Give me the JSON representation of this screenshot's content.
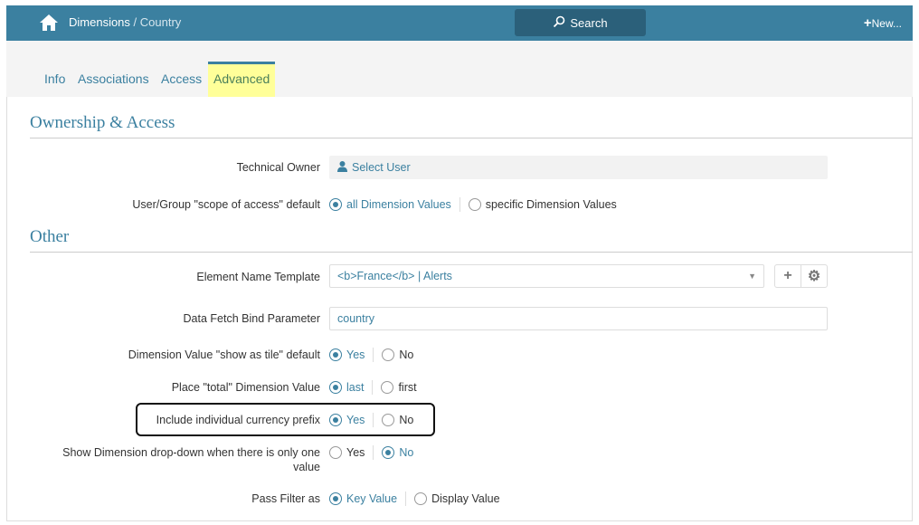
{
  "header": {
    "breadcrumb_main": "Dimensions",
    "breadcrumb_sub": "Country",
    "search_label": "Search",
    "new_label": "New..."
  },
  "tabs": [
    "Info",
    "Associations",
    "Access",
    "Advanced"
  ],
  "sections": {
    "ownership": "Ownership & Access",
    "other": "Other"
  },
  "fields": {
    "technical_owner": {
      "label": "Technical Owner",
      "value": "Select User"
    },
    "scope": {
      "label": "User/Group \"scope of access\" default",
      "options": [
        "all Dimension Values",
        "specific Dimension Values"
      ],
      "selected": 0
    },
    "name_template": {
      "label": "Element Name Template",
      "value": "<b>France</b> | Alerts"
    },
    "bind_param": {
      "label": "Data Fetch Bind Parameter",
      "value": "country"
    },
    "show_tile": {
      "label": "Dimension Value \"show as tile\" default",
      "options": [
        "Yes",
        "No"
      ],
      "selected": 0
    },
    "total_place": {
      "label": "Place \"total\" Dimension Value",
      "options": [
        "last",
        "first"
      ],
      "selected": 0
    },
    "currency_prefix": {
      "label": "Include individual currency prefix",
      "options": [
        "Yes",
        "No"
      ],
      "selected": 0
    },
    "show_dropdown": {
      "label": "Show Dimension drop-down when there is only one value",
      "options": [
        "Yes",
        "No"
      ],
      "selected": 1
    },
    "pass_filter": {
      "label": "Pass Filter as",
      "options": [
        "Key Value",
        "Display Value"
      ],
      "selected": 0
    }
  }
}
